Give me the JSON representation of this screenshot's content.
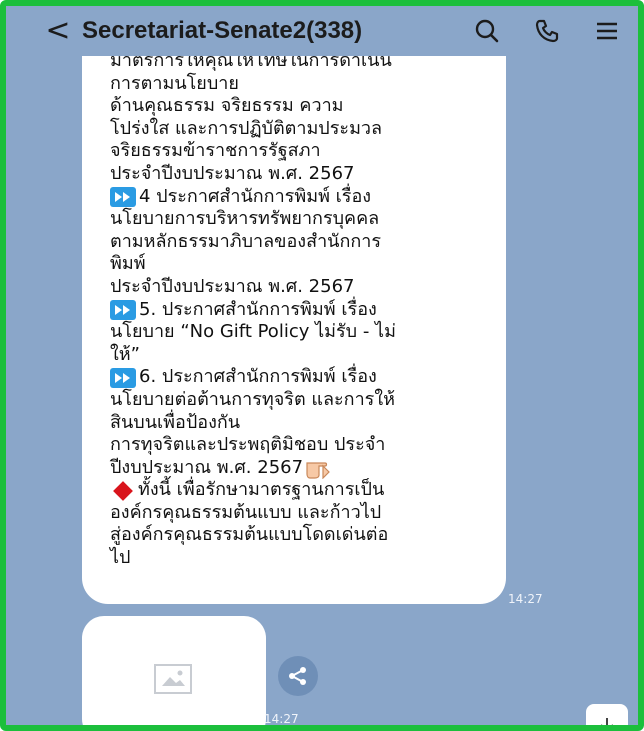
{
  "header": {
    "title": "Secretariat-Senate2(338)",
    "icons": [
      "back-icon",
      "search-icon",
      "phone-icon",
      "menu-icon"
    ]
  },
  "message": {
    "lines": [
      "มาตรการให้คุณให้โทษในการดำเนิน",
      "การตามนโยบาย",
      "ด้านคุณธรรม จริยธรรม ความ",
      "โปร่งใส และการปฏิบัติตามประมวล",
      "จริยธรรมข้าราชการรัฐสภา",
      "ประจำปีงบประมาณ พ.ศ. 2567",
      "4 ประกาศสำนักการพิมพ์ เรื่อง",
      "นโยบายการบริหารทรัพยากรบุคคล",
      "ตามหลักธรรมาภิบาลของสำนักการ",
      "พิมพ์",
      "ประจำปีงบประมาณ พ.ศ. 2567",
      "5. ประกาศสำนักการพิมพ์ เรื่อง",
      "นโยบาย “No Gift Policy ไม่รับ - ไม่",
      "ให้”",
      "6. ประกาศสำนักการพิมพ์ เรื่อง",
      "นโยบายต่อต้านการทุจริต และการให้",
      "สินบนเพื่อป้องกัน",
      "การทุจริตและประพฤติมิชอบ ประจำ",
      "ปีงบประมาณ พ.ศ. 2567",
      "ทั้งนี้ เพื่อรักษามาตรฐานการเป็น",
      "องค์กรคุณธรรมต้นแบบ และก้าวไป",
      "สู่องค์กรคุณธรรมต้นแบบโดดเด่นต่อ",
      "ไป"
    ],
    "time": "14:27"
  },
  "image_message": {
    "time": "14:27",
    "icons": [
      "image-placeholder-icon",
      "share-icon"
    ]
  },
  "scroll_button": {
    "icon": "arrow-down-icon"
  },
  "colors": {
    "chat_background": "#8aa6c9",
    "frame_border": "#1cbf3c",
    "play_badge": "#2a9be3",
    "diamond": "#d9141c"
  }
}
